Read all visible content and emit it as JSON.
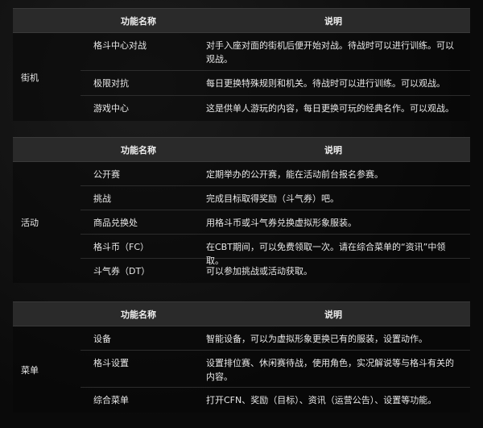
{
  "tables": [
    {
      "header": {
        "col_name": "功能名称",
        "col_desc": "说明"
      },
      "category": "街机",
      "rows": [
        {
          "name": "格斗中心对战",
          "desc": "对手入座对面的街机后便开始对战。待战时可以进行训练。可以观战。"
        },
        {
          "name": "极限对抗",
          "desc": "每日更换特殊规则和机关。待战时可以进行训练。可以观战。"
        },
        {
          "name": "游戏中心",
          "desc": "这是供单人游玩的内容，每日更换可玩的经典名作。可以观战。"
        }
      ]
    },
    {
      "header": {
        "col_name": "功能名称",
        "col_desc": "说明"
      },
      "category": "活动",
      "rows": [
        {
          "name": "公开赛",
          "desc": "定期举办的公开赛，能在活动前台报名参赛。"
        },
        {
          "name": "挑战",
          "desc": "完成目标取得奖励（斗气券）吧。"
        },
        {
          "name": "商品兑换处",
          "desc": "用格斗币或斗气券兑换虚拟形象服装。"
        },
        {
          "name": "格斗币（FC）",
          "desc": "在CBT期间，可以免费领取一次。请在综合菜单的“资讯”中领取。"
        },
        {
          "name": "斗气券（DT）",
          "desc": "可以参加挑战或活动获取。"
        }
      ]
    },
    {
      "header": {
        "col_name": "功能名称",
        "col_desc": "说明"
      },
      "category": "菜单",
      "rows": [
        {
          "name": "设备",
          "desc": "智能设备，可以为虚拟形象更换已有的服装，设置动作。"
        },
        {
          "name": "格斗设置",
          "desc": "设置排位赛、休闲赛待战，使用角色，实况解说等与格斗有关的内容。"
        },
        {
          "name": "综合菜单",
          "desc": "打开CFN、奖励（目标）、资讯（运营公告）、设置等功能。"
        }
      ]
    }
  ]
}
